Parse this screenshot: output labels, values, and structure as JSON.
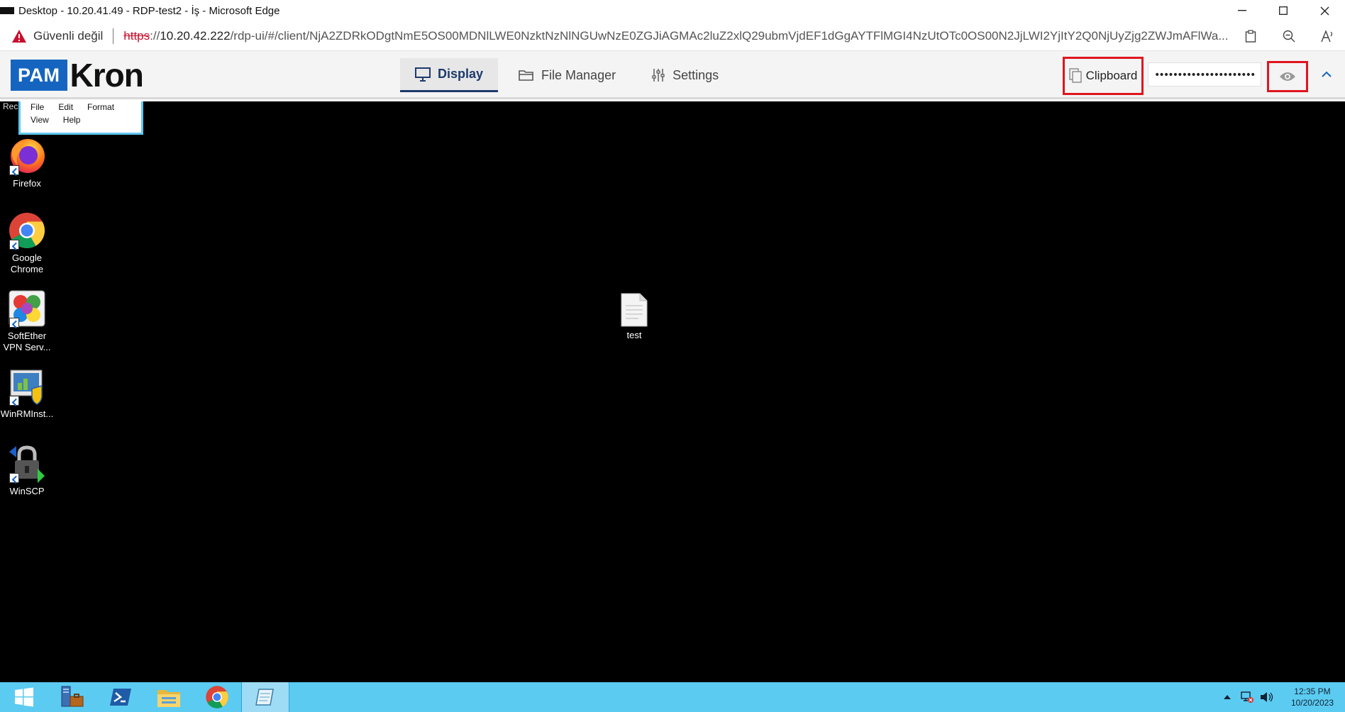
{
  "browser": {
    "title": "Desktop - 10.20.41.49 - RDP-test2 - İş - Microsoft Edge",
    "not_secure": "Güvenli değil",
    "url_scheme": "https",
    "url_sep": "://",
    "url_host": "10.20.42.222",
    "url_path": "/rdp-ui/#/client/NjA2ZDRkODgtNmE5OS00MDNlLWE0NzktNzNlNGUwNzE0ZGJiAGMAc2luZ2xlQ29ubmVjdEF1dGgAYTFlMGI4NzUtOTc0OS00N2JjLWI2YjItY2Q0NjUyZjg2ZWJmAFlWa..."
  },
  "pam": {
    "logo_pam": "PAM",
    "logo_kron": "Kron",
    "tabs": [
      {
        "label": "Display",
        "icon": "monitor-icon"
      },
      {
        "label": "File Manager",
        "icon": "folder-icon"
      },
      {
        "label": "Settings",
        "icon": "sliders-icon"
      }
    ],
    "clipboard_label": "Clipboard",
    "password_value": "••••••••••••••••••••••"
  },
  "desktop": {
    "notepad_menu_row1": [
      "File",
      "Edit",
      "Format"
    ],
    "notepad_menu_row2": [
      "View",
      "Help"
    ],
    "recycle_fragment": "Rec",
    "icons": [
      {
        "name": "firefox",
        "label": "Firefox"
      },
      {
        "name": "chrome",
        "label": "Google Chrome"
      },
      {
        "name": "softether",
        "label": "SoftEther VPN Serv..."
      },
      {
        "name": "winrm",
        "label": "WinRMInst..."
      },
      {
        "name": "winscp",
        "label": "WinSCP"
      }
    ],
    "file_label": "test"
  },
  "taskbar": {
    "time": "12:35 PM",
    "date": "10/20/2023"
  },
  "colors": {
    "highlight": "#e0151f",
    "pam_blue": "#1565c0",
    "taskbar": "#5ccbf1"
  }
}
